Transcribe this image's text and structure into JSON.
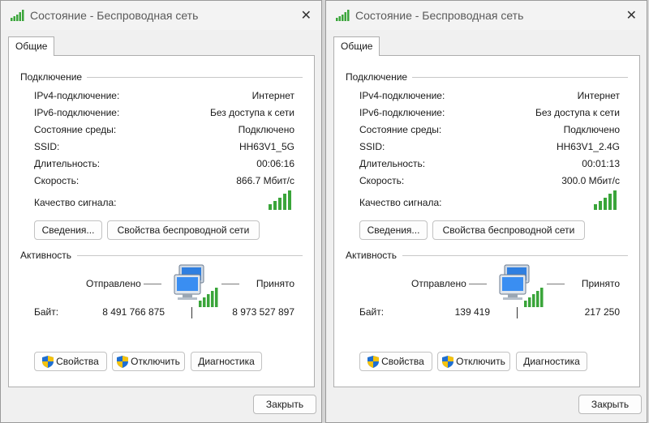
{
  "windows": [
    {
      "title": "Состояние - Беспроводная сеть",
      "tab": "Общие",
      "connection_header": "Подключение",
      "rows": [
        {
          "label": "IPv4-подключение:",
          "value": "Интернет"
        },
        {
          "label": "IPv6-подключение:",
          "value": "Без доступа к сети"
        },
        {
          "label": "Состояние среды:",
          "value": "Подключено"
        },
        {
          "label": "SSID:",
          "value": "HH63V1_5G"
        },
        {
          "label": "Длительность:",
          "value": "00:06:16"
        },
        {
          "label": "Скорость:",
          "value": "866.7 Мбит/с"
        }
      ],
      "signal_label": "Качество сигнала:",
      "signal_level": 5,
      "details_button": "Сведения...",
      "wireless_props_button": "Свойства беспроводной сети",
      "activity_header": "Активность",
      "sent_label": "Отправлено",
      "received_label": "Принято",
      "bytes_label": "Байт:",
      "bytes_sent": "8 491 766 875",
      "bytes_received": "8 973 527 897",
      "props_button": "Свойства",
      "disconnect_button": "Отключить",
      "diagnostics_button": "Диагностика",
      "close_button": "Закрыть"
    },
    {
      "title": "Состояние - Беспроводная сеть",
      "tab": "Общие",
      "connection_header": "Подключение",
      "rows": [
        {
          "label": "IPv4-подключение:",
          "value": "Интернет"
        },
        {
          "label": "IPv6-подключение:",
          "value": "Без доступа к сети"
        },
        {
          "label": "Состояние среды:",
          "value": "Подключено"
        },
        {
          "label": "SSID:",
          "value": "HH63V1_2.4G"
        },
        {
          "label": "Длительность:",
          "value": "00:01:13"
        },
        {
          "label": "Скорость:",
          "value": "300.0 Мбит/с"
        }
      ],
      "signal_label": "Качество сигнала:",
      "signal_level": 5,
      "details_button": "Сведения...",
      "wireless_props_button": "Свойства беспроводной сети",
      "activity_header": "Активность",
      "sent_label": "Отправлено",
      "received_label": "Принято",
      "bytes_label": "Байт:",
      "bytes_sent": "139 419",
      "bytes_received": "217 250",
      "props_button": "Свойства",
      "disconnect_button": "Отключить",
      "diagnostics_button": "Диагностика",
      "close_button": "Закрыть"
    }
  ],
  "colors": {
    "signal_green": "#3aa53a",
    "shield_blue": "#1f6fd1",
    "shield_yellow": "#f4c20d"
  },
  "icons": {
    "title": "wifi-signal-icon",
    "close": "close-icon",
    "activity": "network-computers-icon",
    "shield": "uac-shield-icon"
  }
}
